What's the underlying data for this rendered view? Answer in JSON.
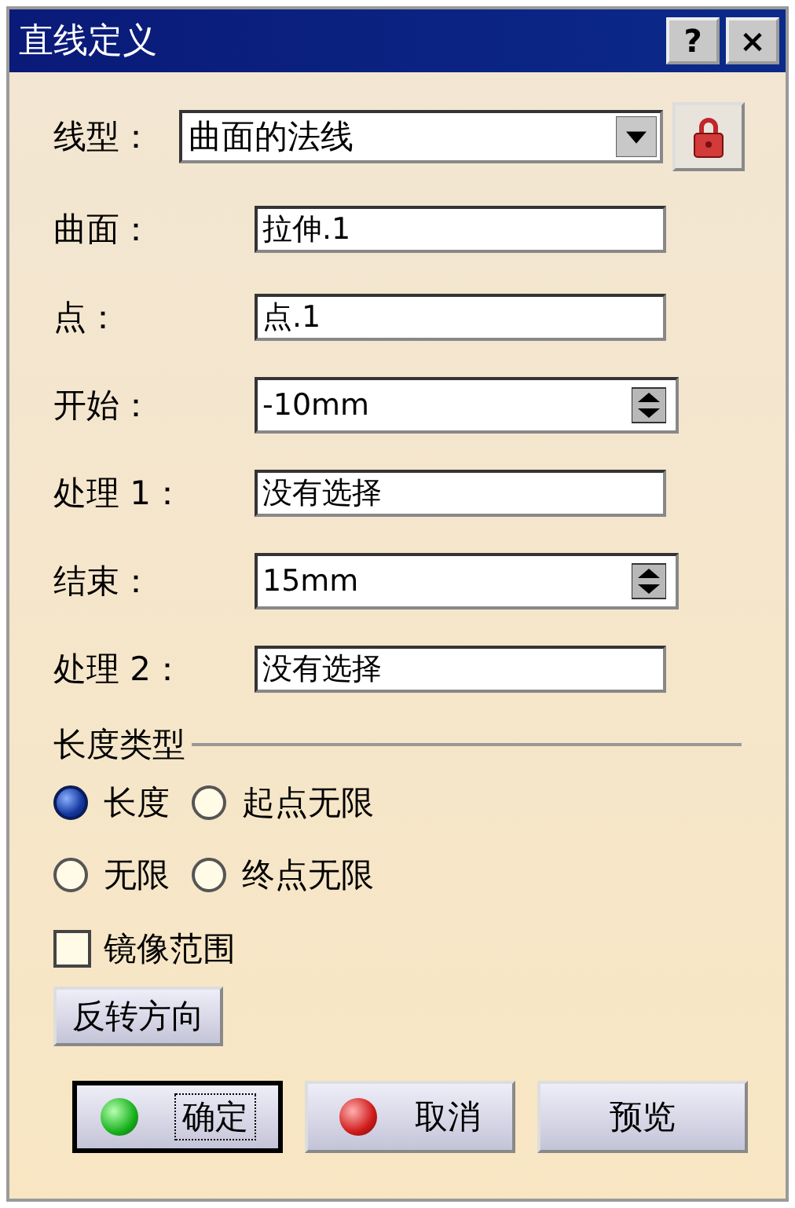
{
  "window": {
    "title": "直线定义",
    "help_button": "?",
    "close_button": "×"
  },
  "line_type": {
    "label": "线型：",
    "value": "曲面的法线"
  },
  "fields": [
    {
      "kind": "text",
      "label": "曲面：",
      "value": "拉伸.1"
    },
    {
      "kind": "text",
      "label": "点：",
      "value": "点.1"
    },
    {
      "kind": "spin",
      "label": "开始：",
      "value": "-10mm"
    },
    {
      "kind": "text",
      "label": "处理 1：",
      "value": "没有选择"
    },
    {
      "kind": "spin",
      "label": "结束：",
      "value": "15mm"
    },
    {
      "kind": "text",
      "label": "处理 2：",
      "value": "没有选择"
    }
  ],
  "length_type": {
    "title": "长度类型",
    "options": [
      {
        "label": "长度",
        "selected": true
      },
      {
        "label": "起点无限",
        "selected": false
      },
      {
        "label": "无限",
        "selected": false
      },
      {
        "label": "终点无限",
        "selected": false
      }
    ]
  },
  "mirror": {
    "label": "镜像范围",
    "checked": false
  },
  "reverse_button": "反转方向",
  "buttons": [
    {
      "kind": "ok",
      "label": "确定",
      "default": true
    },
    {
      "kind": "cancel",
      "label": "取消",
      "default": false
    },
    {
      "kind": "preview",
      "label": "预览",
      "default": false
    }
  ]
}
